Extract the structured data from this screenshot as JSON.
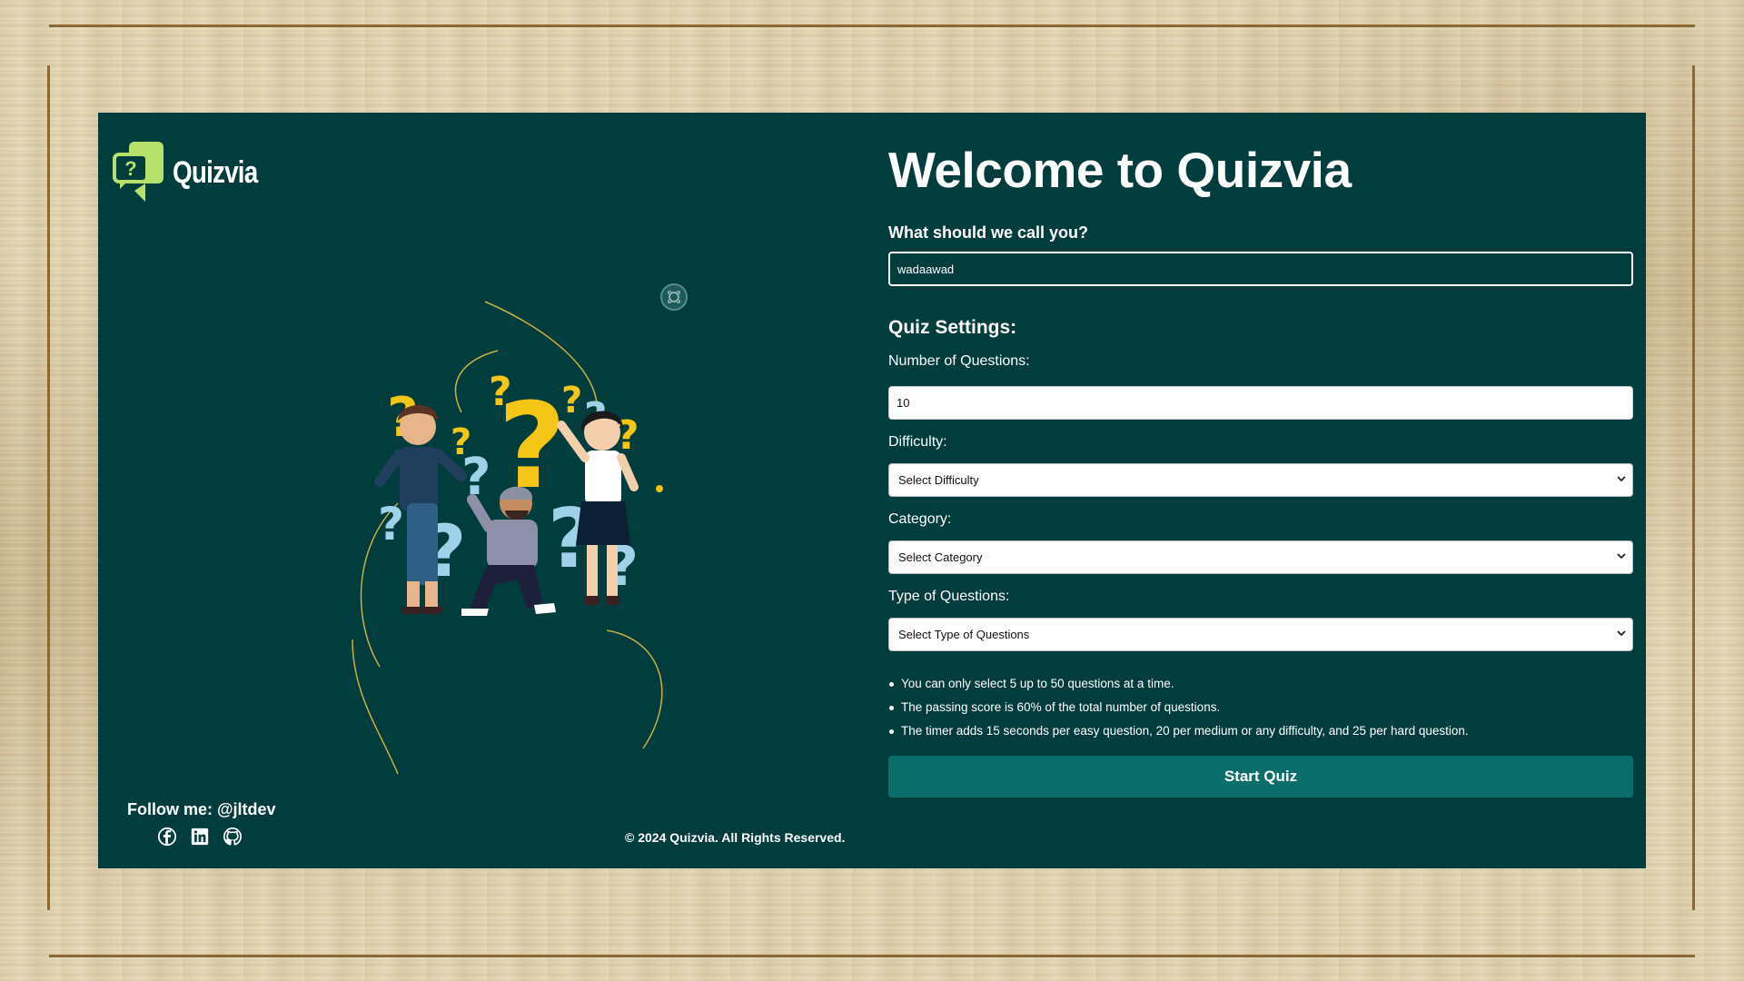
{
  "app": {
    "logo_text": "Quizvia"
  },
  "main": {
    "title": "Welcome to Quizvia",
    "name_label": "What should we call you?",
    "name_value": "wadaawad",
    "settings_title": "Quiz Settings:",
    "num_questions_label": "Number of Questions:",
    "num_questions_value": "10",
    "difficulty_label": "Difficulty:",
    "difficulty_selected": "Select Difficulty",
    "category_label": "Category:",
    "category_selected": "Select Category",
    "type_label": "Type of Questions:",
    "type_selected": "Select Type of Questions",
    "notes": [
      "You can only select 5 up to 50 questions at a time.",
      "The passing score is 60% of the total number of questions.",
      "The timer adds 15 seconds per easy question, 20 per medium or any difficulty, and 25 per hard question."
    ],
    "start_label": "Start Quiz"
  },
  "footer": {
    "follow": "Follow me: @jltdev",
    "copyright": "© 2024 Quizvia. All Rights Reserved.",
    "socials": [
      "facebook-icon",
      "linkedin-icon",
      "github-icon"
    ]
  },
  "colors": {
    "card_bg": "#023d3d",
    "accent": "#0b6e6b",
    "logo_green": "#b6e26b",
    "question_yellow": "#f5c518",
    "question_blue": "#9fd1e8"
  }
}
